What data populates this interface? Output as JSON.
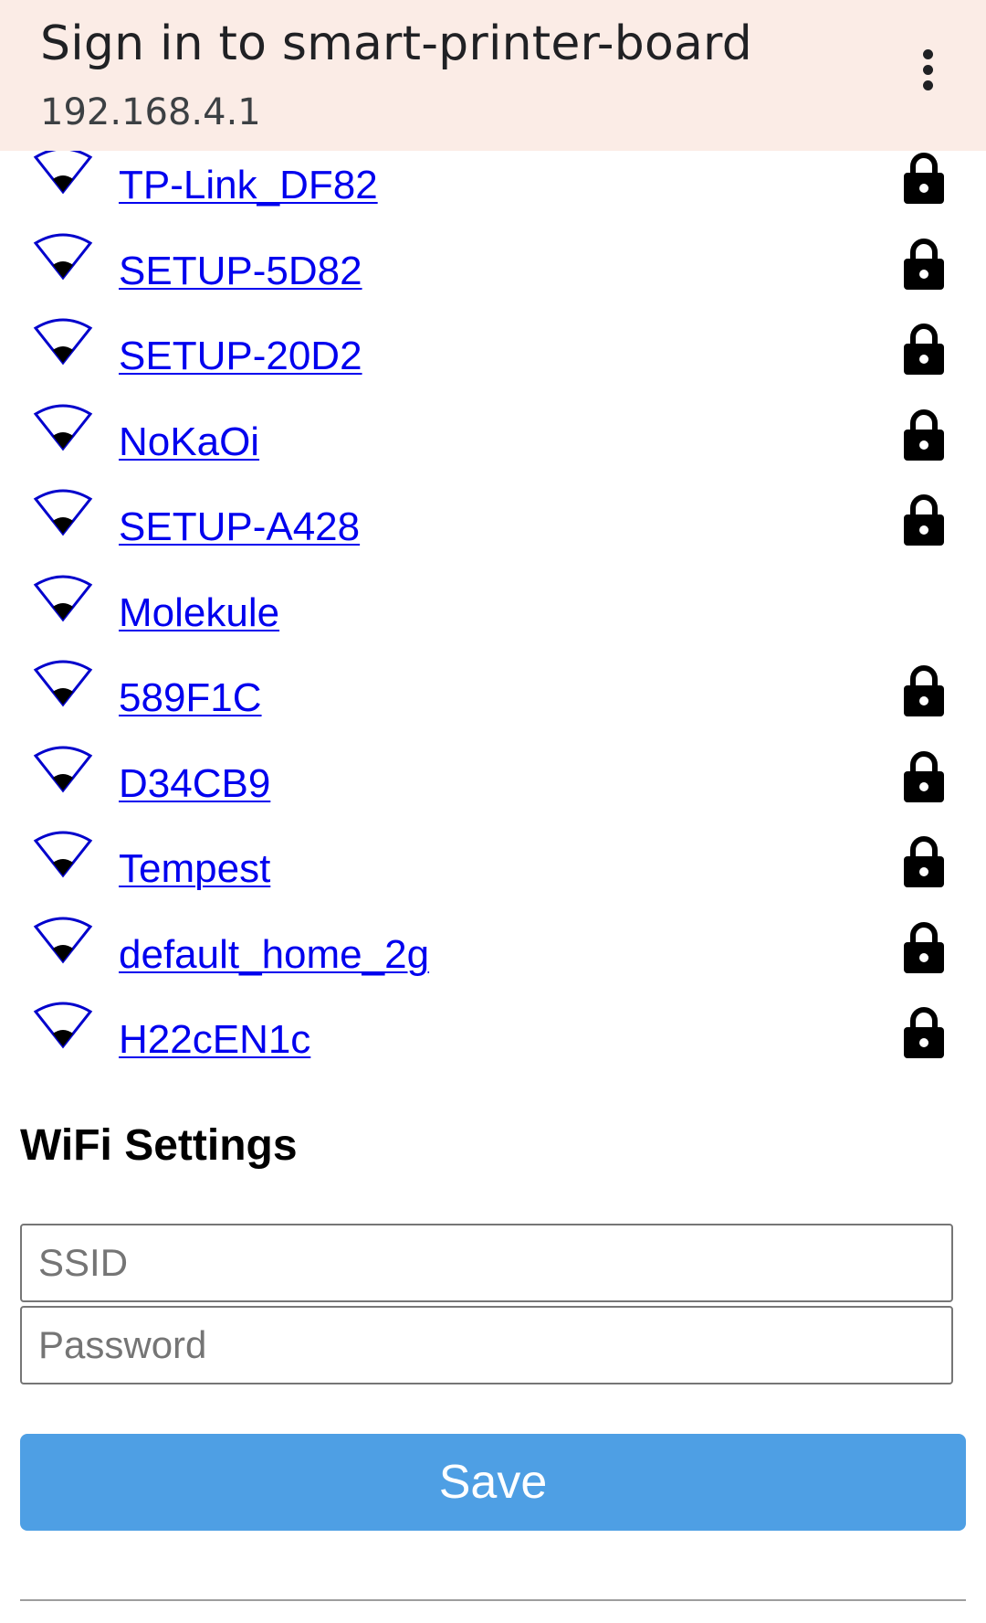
{
  "header": {
    "title": "Sign in to smart-printer-board",
    "subtitle": "192.168.4.1",
    "menu_icon": "more-vert-icon"
  },
  "networks": [
    {
      "ssid": "TP-Link_DF82",
      "secured": true
    },
    {
      "ssid": "SETUP-5D82",
      "secured": true
    },
    {
      "ssid": "SETUP-20D2",
      "secured": true
    },
    {
      "ssid": "NoKaOi",
      "secured": true
    },
    {
      "ssid": "SETUP-A428",
      "secured": true
    },
    {
      "ssid": "Molekule",
      "secured": false
    },
    {
      "ssid": "589F1C",
      "secured": true
    },
    {
      "ssid": "D34CB9",
      "secured": true
    },
    {
      "ssid": "Tempest",
      "secured": true
    },
    {
      "ssid": "default_home_2g",
      "secured": true
    },
    {
      "ssid": "H22cEN1c",
      "secured": true
    }
  ],
  "wifi_settings": {
    "title": "WiFi Settings",
    "ssid_placeholder": "SSID",
    "password_placeholder": "Password",
    "save_label": "Save"
  },
  "colors": {
    "header_bg": "#fbece6",
    "link": "#0000ee",
    "save_button": "#4e9fe4"
  }
}
